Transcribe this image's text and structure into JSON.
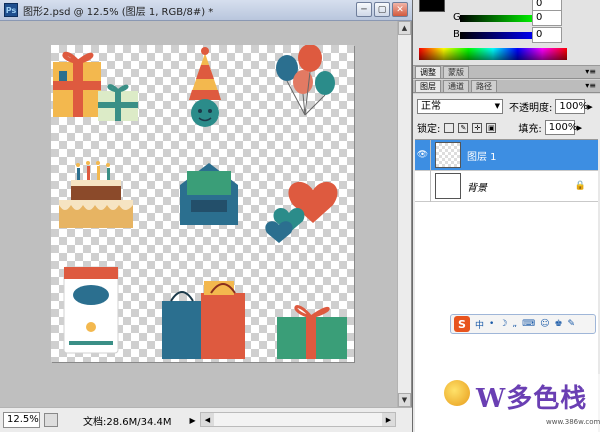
{
  "window": {
    "app_icon_label": "Ps",
    "title": "图形2.psd @ 12.5% (图层 1, RGB/8#) *",
    "minimize": "─",
    "restore": "▢",
    "close": "✕"
  },
  "status": {
    "zoom": "12.5%",
    "doc_info": "文档:28.6M/34.4M",
    "arrow": "▶"
  },
  "color_panel": {
    "channels": [
      {
        "name": "G",
        "value": "0",
        "color": "#00ff00"
      },
      {
        "name": "B",
        "value": "0",
        "color": "#0000ff"
      }
    ],
    "top_value": "0"
  },
  "tabs_top": [
    "调整",
    "蒙版"
  ],
  "tabs_layers": [
    "图层",
    "通道",
    "路径"
  ],
  "layers_panel": {
    "blend_mode": "正常",
    "opacity_label": "不透明度:",
    "opacity_value": "100%",
    "lock_label": "锁定:",
    "fill_label": "填充:",
    "fill_value": "100%",
    "layers": [
      {
        "name": "图层 1",
        "selected": true,
        "visible": true
      },
      {
        "name": "背景",
        "selected": false,
        "visible": false,
        "locked": true
      }
    ]
  },
  "ime_bar": {
    "logo": "S",
    "items": [
      "中",
      "•",
      "☽",
      "„",
      "⌨",
      "☺",
      "♚",
      "✎"
    ]
  },
  "watermark": {
    "text": "W多色栈",
    "url": "www.386w.com"
  },
  "colors": {
    "accent_selected": "#3d8ee2",
    "canvas_bg": "#bfbfbf"
  }
}
